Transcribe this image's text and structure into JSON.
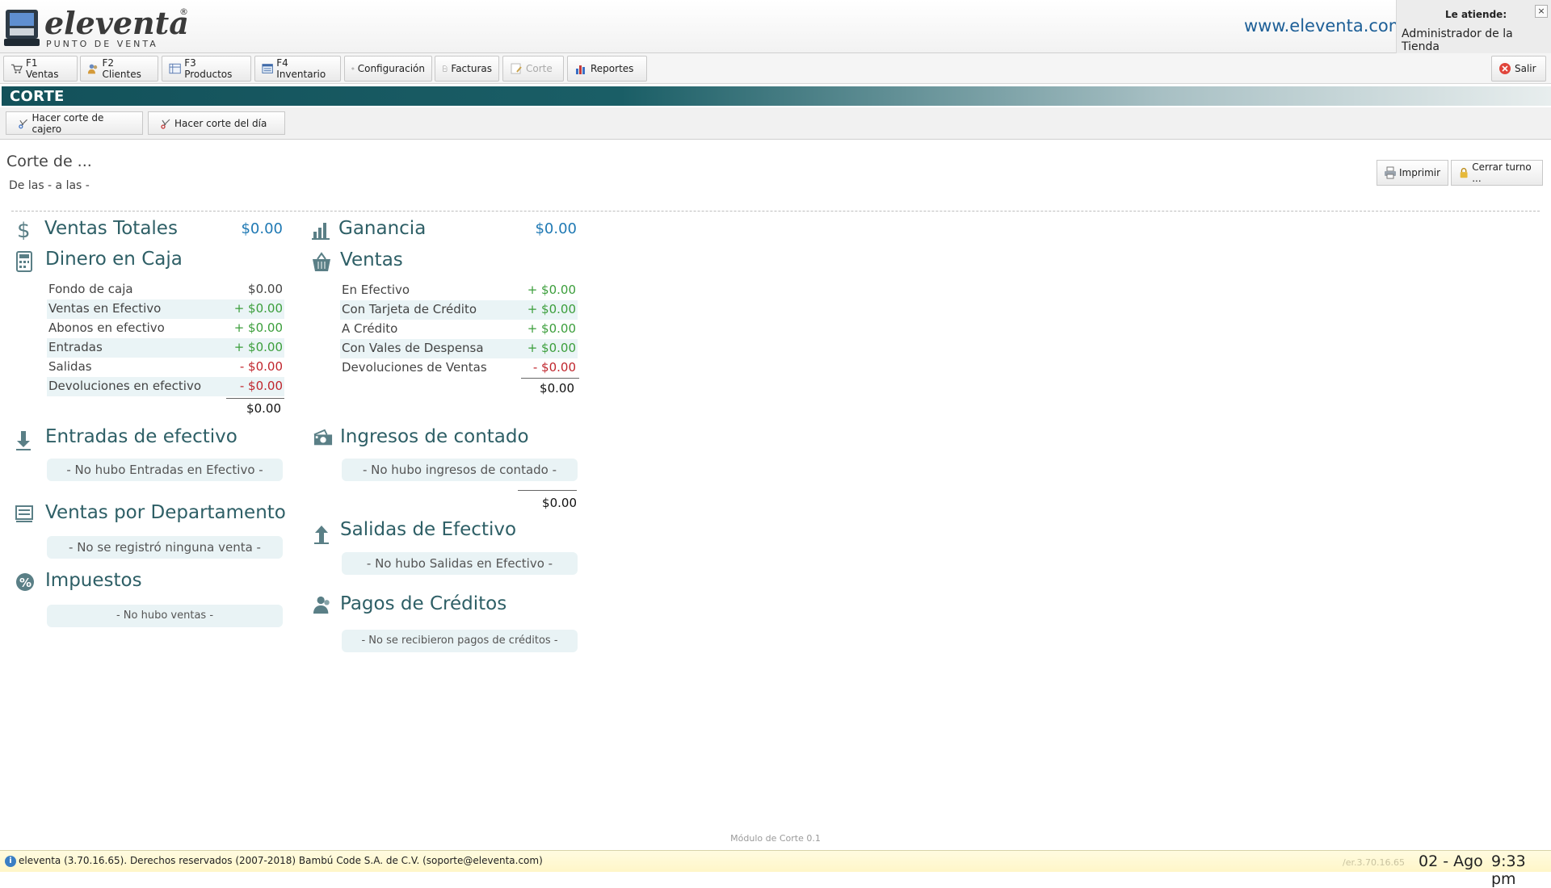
{
  "header": {
    "logo_text": "eleventa",
    "logo_sub": "PUNTO DE VENTA",
    "logo_reg": "®",
    "site": "www.eleventa.com",
    "attend_label": "Le atiende:",
    "attend_name": "Administrador de la Tienda",
    "close_glyph": "×"
  },
  "toolbar": {
    "items": [
      {
        "label": "F1 Ventas",
        "icon": "cart-icon"
      },
      {
        "label": "F2 Clientes",
        "icon": "clients-icon"
      },
      {
        "label": "F3 Productos",
        "icon": "products-icon"
      },
      {
        "label": "F4 Inventario",
        "icon": "inventory-icon"
      },
      {
        "label": "Configuración",
        "icon": "gear-icon"
      },
      {
        "label": "Facturas",
        "icon": "invoice-icon"
      },
      {
        "label": "Corte",
        "icon": "corte-icon"
      },
      {
        "label": "Reportes",
        "icon": "chart-icon"
      }
    ],
    "exit_label": "Salir"
  },
  "page": {
    "title": "CORTE",
    "btn_cajero": "Hacer corte de cajero",
    "btn_dia": "Hacer corte del día",
    "corte_title": "Corte de ...",
    "corte_range": "De las - a las -",
    "print_label": "Imprimir",
    "close_shift_label": "Cerrar turno ..."
  },
  "ventas_totales": {
    "title": "Ventas Totales",
    "amount": "$0.00"
  },
  "ganancia": {
    "title": "Ganancia",
    "amount": "$0.00"
  },
  "dinero_caja": {
    "title": "Dinero en Caja",
    "rows": [
      {
        "label": "Fondo de caja",
        "value": "$0.00"
      },
      {
        "label": "Ventas en Efectivo",
        "value": "+ $0.00"
      },
      {
        "label": "Abonos en efectivo",
        "value": "+ $0.00"
      },
      {
        "label": "Entradas",
        "value": "+ $0.00"
      },
      {
        "label": "Salidas",
        "value": "- $0.00"
      },
      {
        "label": "Devoluciones en efectivo",
        "value": "- $0.00"
      }
    ],
    "total": "$0.00"
  },
  "ventas": {
    "title": "Ventas",
    "rows": [
      {
        "label": "En Efectivo",
        "value": "+ $0.00"
      },
      {
        "label": "Con Tarjeta de Crédito",
        "value": "+ $0.00"
      },
      {
        "label": "A Crédito",
        "value": "+ $0.00"
      },
      {
        "label": "Con Vales de Despensa",
        "value": "+ $0.00"
      },
      {
        "label": "Devoluciones de Ventas",
        "value": "- $0.00"
      }
    ],
    "total": "$0.00"
  },
  "entradas": {
    "title": "Entradas de efectivo",
    "empty": "- No hubo Entradas en Efectivo -"
  },
  "ingresos": {
    "title": "Ingresos de contado",
    "empty": "- No hubo ingresos de contado -",
    "total": "$0.00"
  },
  "departamento": {
    "title": "Ventas por Departamento",
    "empty": "- No se registró ninguna venta -"
  },
  "salidas": {
    "title": "Salidas de Efectivo",
    "empty": "- No hubo Salidas en Efectivo -"
  },
  "impuestos": {
    "title": "Impuestos",
    "empty": "- No hubo ventas -"
  },
  "pagos": {
    "title": "Pagos de Créditos",
    "empty": "- No se recibieron pagos de créditos -"
  },
  "module_note": "Módulo de Corte 0.1",
  "status": {
    "info": "i",
    "text": "eleventa (3.70.16.65). Derechos reservados (2007-2018) Bambú Code S.A. de C.V. (soporte@eleventa.com)",
    "version": "/er.3.70.16.65",
    "date": "02 - Ago",
    "time": "9:33 pm"
  },
  "colors": {
    "accent": "#1d5f97",
    "section": "#2e5f66",
    "positive": "#3b9e3b",
    "negative": "#c0262d"
  }
}
